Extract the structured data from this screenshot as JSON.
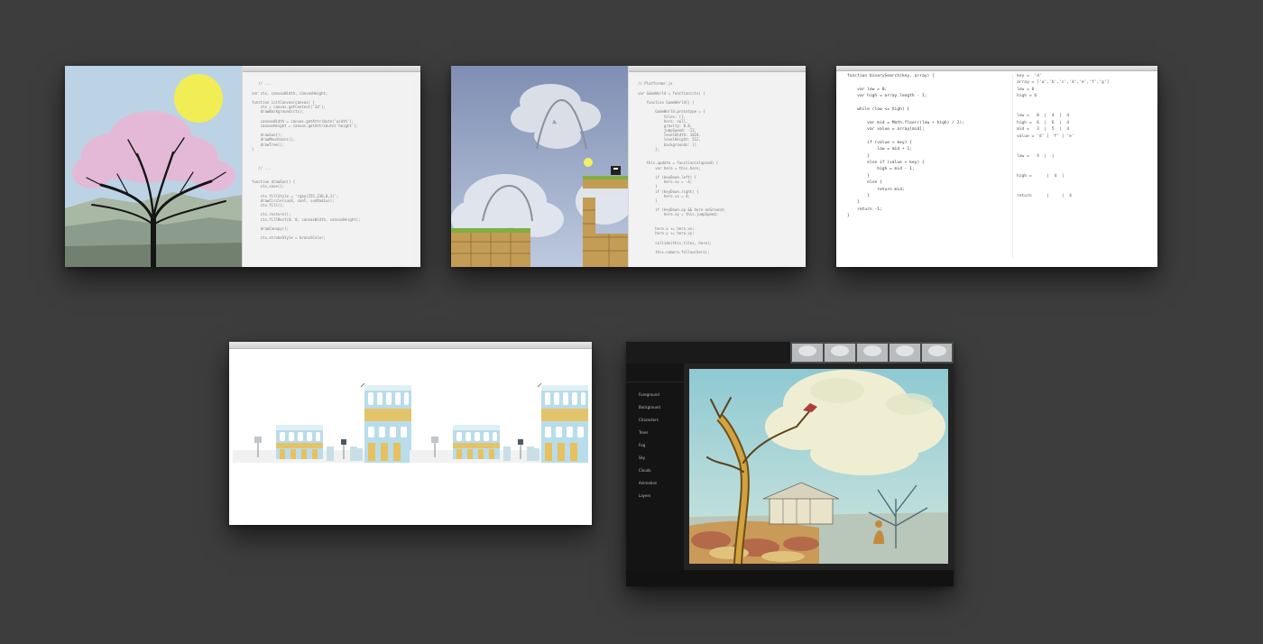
{
  "windows": [
    {
      "id": "cherry-blossom-window",
      "code_lines": [
        "",
        "   // ...",
        "",
        "var ctx, canvasWidth, canvasHeight;",
        "",
        "function initCanvas(canvas) {",
        "    ctx = canvas.getContext('2d');",
        "    drawBackground(ctx);",
        "",
        "    canvasWidth = canvas.getAttribute('width');",
        "    canvasHeight = canvas.getAttribute('height');",
        "",
        "    drawSun();",
        "    drawMountains();",
        "    drawTree();",
        "}",
        "",
        "",
        "",
        "   // ...",
        "",
        "",
        "function drawSun() {",
        "    ctx.save();",
        "",
        "    ctx.fillStyle = 'rgba(255,230,0,1)';",
        "    drawCircle(sunX, sunY, sunRadius);",
        "    ctx.fill();",
        "",
        "    ctx.restore();",
        "    ctx.fillRect(0, 0, canvasWidth, canvasHeight);",
        "",
        "    drawCanopy();",
        "",
        "    ctx.strokeStyle = branchColor;"
      ]
    },
    {
      "id": "platformer-window",
      "code_lines": [
        "",
        "// Platformer.js",
        "",
        "var GameWorld = function(ctx) {",
        "",
        "    function GameWorld() {",
        "",
        "        GameWorld.prototype = {",
        "            tiles: [],",
        "            hero: null,",
        "            gravity: 0.8,",
        "            jumpSpeed: -12,",
        "            levelWidth: 1024,",
        "            levelHeight: 512,",
        "            backgrounds: []",
        "        };",
        "",
        "",
        "    this.update = function(elapsed) {",
        "        var hero = this.hero;",
        "",
        "        if (keyDown.left) {",
        "            hero.vx = -4;",
        "        }",
        "        if (keyDown.right) {",
        "            hero.vx = 4;",
        "        }",
        "",
        "        if (keyDown.up && hero.onGround)",
        "            hero.vy = this.jumpSpeed;",
        "",
        "",
        "        hero.x += hero.vx;",
        "        hero.y += hero.vy;",
        "",
        "        collide(this.tiles, hero);",
        "",
        "        this.camera.follow(hero);"
      ]
    },
    {
      "id": "binary-search-window",
      "code_lines": [
        "function binarySearch(key, array) {",
        "",
        "    var low = 0;",
        "    var high = array.length - 1;",
        "",
        "    while (low <= high) {",
        "",
        "        var mid = Math.floor((low + high) / 2);",
        "        var value = array[mid];",
        "",
        "        if (value < key) {",
        "            low = mid + 1;",
        "        }",
        "        else if (value > key) {",
        "            high = mid - 1;",
        "        }",
        "        else {",
        "            return mid;",
        "        }",
        "    }",
        "    return -1;",
        "}"
      ],
      "trace_lines": [
        "key =  'd'",
        "array = ['a','b','c','d','e','f','g']",
        "low = 0",
        "high = 6",
        "",
        "",
        "low =   0  |  4  |  4",
        "high =  6  |  6  |  4",
        "mid =   3  |  5  |  4",
        "value = 'd' | 'f' | 'e'",
        "",
        "",
        "low =   4  |  |",
        "",
        "",
        "high =      |  4  |",
        "",
        "",
        "return      |     |  4"
      ]
    },
    {
      "id": "building-generator-window"
    },
    {
      "id": "illustration-editor-window",
      "sidebar_items": [
        "Foreground",
        "Background",
        "Characters",
        "Trees",
        "Fog",
        "Sky",
        "Clouds",
        "Animation",
        "Layers"
      ]
    }
  ]
}
